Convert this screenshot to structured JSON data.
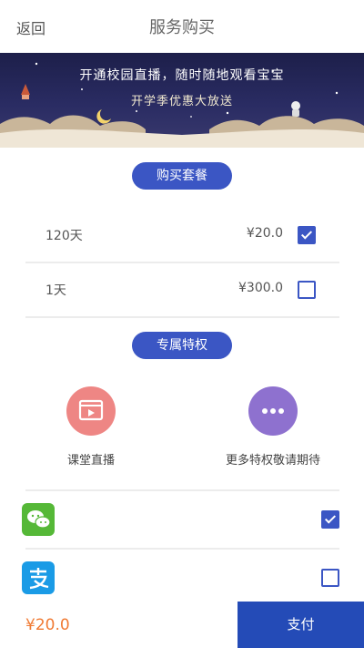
{
  "header": {
    "back_label": "返回",
    "title": "服务购买"
  },
  "banner": {
    "line1": "开通校园直播，随时随地观看宝宝",
    "line2": "开学季优惠大放送"
  },
  "purchase": {
    "section_label": "购买套餐",
    "plans": [
      {
        "name": "120天",
        "price": "¥20.0",
        "selected": true
      },
      {
        "name": "1天",
        "price": "¥300.0",
        "selected": false
      }
    ]
  },
  "privileges": {
    "section_label": "专属特权",
    "items": [
      {
        "label": "课堂直播",
        "icon": "video-icon",
        "color": "#ee8684"
      },
      {
        "label": "更多特权敬请期待",
        "icon": "more-icon",
        "color": "#8e71cf"
      }
    ]
  },
  "payment_methods": [
    {
      "icon": "wechat-pay-icon",
      "color": "#55b837",
      "selected": true
    },
    {
      "icon": "alipay-icon",
      "color": "#1a9be6",
      "selected": false
    }
  ],
  "footer": {
    "total": "¥20.0",
    "pay_label": "支付"
  },
  "colors": {
    "accent": "#3b56c4",
    "pay_button": "#244bb7",
    "price": "#f07a33"
  }
}
